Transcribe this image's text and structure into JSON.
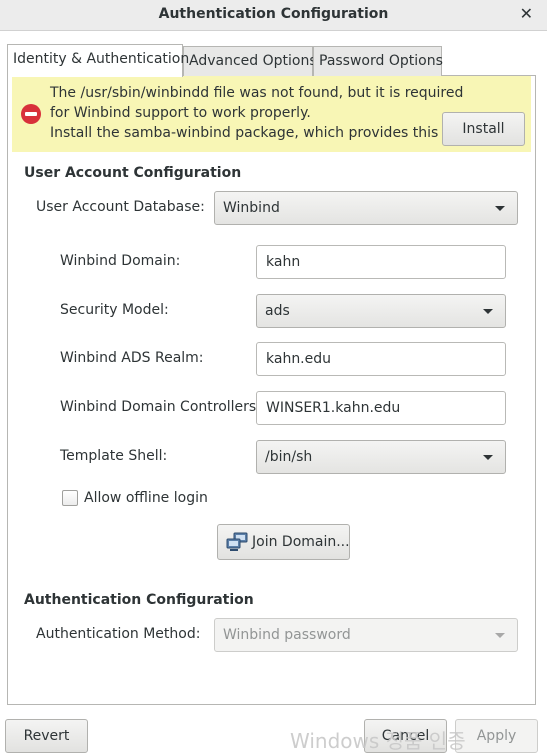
{
  "window": {
    "title": "Authentication Configuration"
  },
  "tabs": [
    {
      "label": "Identity & Authentication",
      "active": true
    },
    {
      "label": "Advanced Options",
      "active": false
    },
    {
      "label": "Password Options",
      "active": false
    }
  ],
  "info_bar": {
    "lines": [
      "The /usr/sbin/winbindd file was not found, but it is required",
      "for Winbind support to work properly.",
      "Install the samba-winbind package, which provides this file."
    ],
    "install_label": "Install",
    "icon": "error-icon",
    "color": "#f8f6b5"
  },
  "user_account": {
    "section_title": "User Account Configuration",
    "database_label": "User Account Database:",
    "database_value": "Winbind",
    "fields": {
      "domain_label": "Winbind Domain:",
      "domain_value": "kahn",
      "security_label": "Security Model:",
      "security_value": "ads",
      "realm_label": "Winbind ADS Realm:",
      "realm_value": "kahn.edu",
      "controllers_label": "Winbind Domain Controllers:",
      "controllers_value": "WINSER1.kahn.edu",
      "shell_label": "Template Shell:",
      "shell_value": "/bin/sh"
    },
    "offline_label": "Allow offline login",
    "offline_checked": false,
    "join_label": "Join Domain..."
  },
  "authentication": {
    "section_title": "Authentication Configuration",
    "method_label": "Authentication Method:",
    "method_value": "Winbind password",
    "method_enabled": false
  },
  "footer": {
    "revert_label": "Revert",
    "cancel_label": "Cancel",
    "apply_label": "Apply",
    "apply_enabled": false
  },
  "watermark": "Windows 정품 인증"
}
